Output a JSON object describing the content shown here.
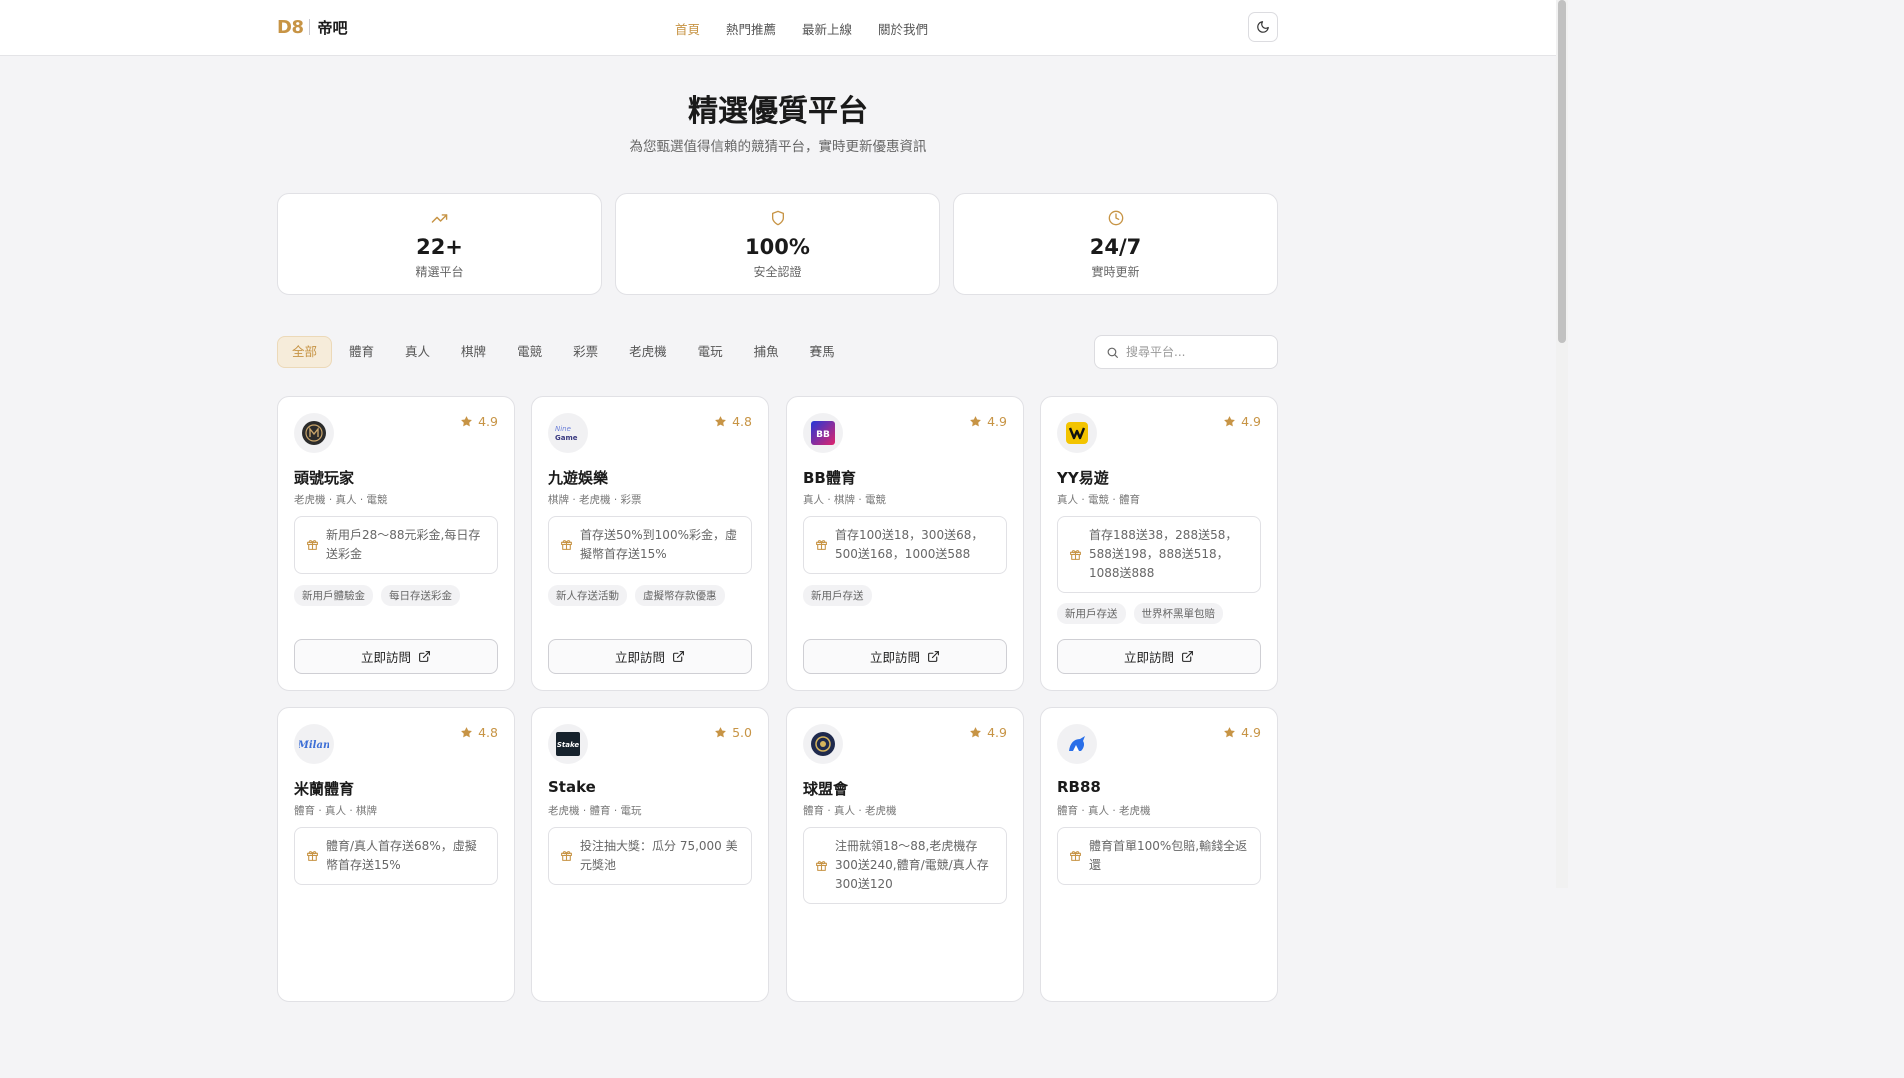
{
  "header": {
    "logo": "D8",
    "name": "帝吧",
    "nav": [
      "首頁",
      "熱門推薦",
      "最新上線",
      "關於我們"
    ],
    "theme_icon": "moon-icon"
  },
  "hero": {
    "title": "精選優質平台",
    "subtitle": "為您甄選值得信賴的競猜平台，實時更新優惠資訊"
  },
  "stats": [
    {
      "icon": "trending-up-icon",
      "value": "22+",
      "label": "精選平台"
    },
    {
      "icon": "shield-icon",
      "value": "100%",
      "label": "安全認證"
    },
    {
      "icon": "clock-icon",
      "value": "24/7",
      "label": "實時更新"
    }
  ],
  "filters": [
    "全部",
    "體育",
    "真人",
    "棋牌",
    "電競",
    "彩票",
    "老虎機",
    "電玩",
    "捕魚",
    "賽馬"
  ],
  "search": {
    "placeholder": "搜尋平台..."
  },
  "visit_label": "立即訪問",
  "platforms": [
    {
      "name": "頭號玩家",
      "rating": "4.9",
      "tags": "老虎機 · 真人 · 電競",
      "promo": "新用戶28～88元彩金,每日存送彩金",
      "badges": [
        "新用戶體驗金",
        "每日存送彩金"
      ]
    },
    {
      "name": "九遊娛樂",
      "rating": "4.8",
      "tags": "棋牌 · 老虎機 · 彩票",
      "promo": "首存送50%到100%彩金，虛擬幣首存送15%",
      "badges": [
        "新人存送活動",
        "虛擬幣存款優惠"
      ]
    },
    {
      "name": "BB體育",
      "rating": "4.9",
      "tags": "真人 · 棋牌 · 電競",
      "promo": "首存100送18，300送68，500送168，1000送588",
      "badges": [
        "新用戶存送"
      ]
    },
    {
      "name": "YY易遊",
      "rating": "4.9",
      "tags": "真人 · 電競 · 體育",
      "promo": "首存188送38，288送58，588送198，888送518，1088送888",
      "badges": [
        "新用戶存送",
        "世界杯黑單包賠"
      ]
    },
    {
      "name": "米蘭體育",
      "rating": "4.8",
      "tags": "體育 · 真人 · 棋牌",
      "promo": "體育/真人首存送68%，虛擬幣首存送15%",
      "badges": []
    },
    {
      "name": "Stake",
      "rating": "5.0",
      "tags": "老虎機 · 體育 · 電玩",
      "promo": "投注抽大獎：瓜分 75,000 美元獎池",
      "badges": []
    },
    {
      "name": "球盟會",
      "rating": "4.9",
      "tags": "體育 · 真人 · 老虎機",
      "promo": "注冊就領18～88,老虎機存300送240,體育/電競/真人存300送120",
      "badges": []
    },
    {
      "name": "RB88",
      "rating": "4.9",
      "tags": "體育 · 真人 · 老虎機",
      "promo": "體育首單100%包賠,輸錢全返還",
      "badges": []
    }
  ],
  "logo_colors": [
    "#2b2b2b",
    "#6b7fd8",
    "#2438d8",
    "#f3c400",
    "#3d6fd6",
    "#16222c",
    "#1f2a4d",
    "#2a6fe8"
  ]
}
